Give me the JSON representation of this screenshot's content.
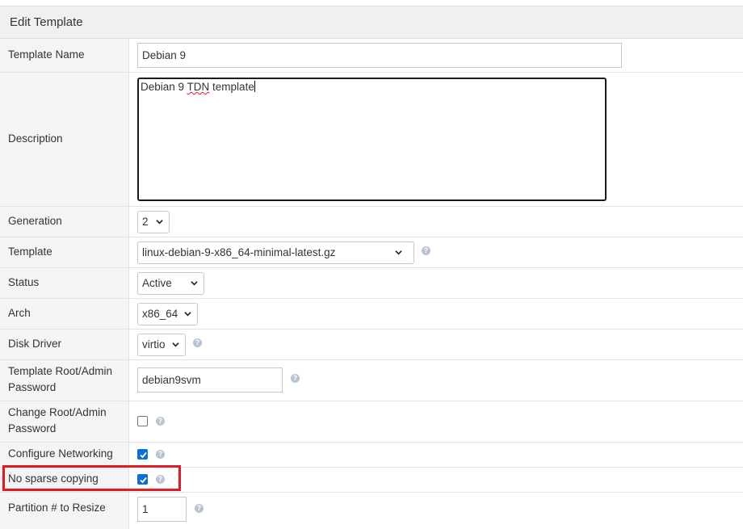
{
  "panel": {
    "title": "Edit Template"
  },
  "fields": {
    "template_name": {
      "label": "Template Name",
      "value": "Debian 9"
    },
    "description": {
      "label": "Description",
      "value_prefix": "Debian 9 ",
      "value_misspelled": "TDN",
      "value_suffix": " template"
    },
    "generation": {
      "label": "Generation",
      "value": "2"
    },
    "template": {
      "label": "Template",
      "value": "linux-debian-9-x86_64-minimal-latest.gz"
    },
    "status": {
      "label": "Status",
      "value": "Active"
    },
    "arch": {
      "label": "Arch",
      "value": "x86_64"
    },
    "disk_driver": {
      "label": "Disk Driver",
      "value": "virtio"
    },
    "root_password": {
      "label_line1": "Template Root/Admin",
      "label_line2": "Password",
      "value": "debian9svm"
    },
    "change_root_password": {
      "label_line1": "Change Root/Admin",
      "label_line2": "Password",
      "checked": false
    },
    "configure_networking": {
      "label": "Configure Networking",
      "checked": true
    },
    "no_sparse_copying": {
      "label": "No sparse copying",
      "checked": true
    },
    "partition_resize": {
      "label": "Partition # to Resize",
      "value": "1"
    }
  },
  "help_icon": "question-circle-icon",
  "colors": {
    "accent": "#0b6fd6",
    "highlight": "#e01b24",
    "label_bg": "#f4f4f4"
  }
}
